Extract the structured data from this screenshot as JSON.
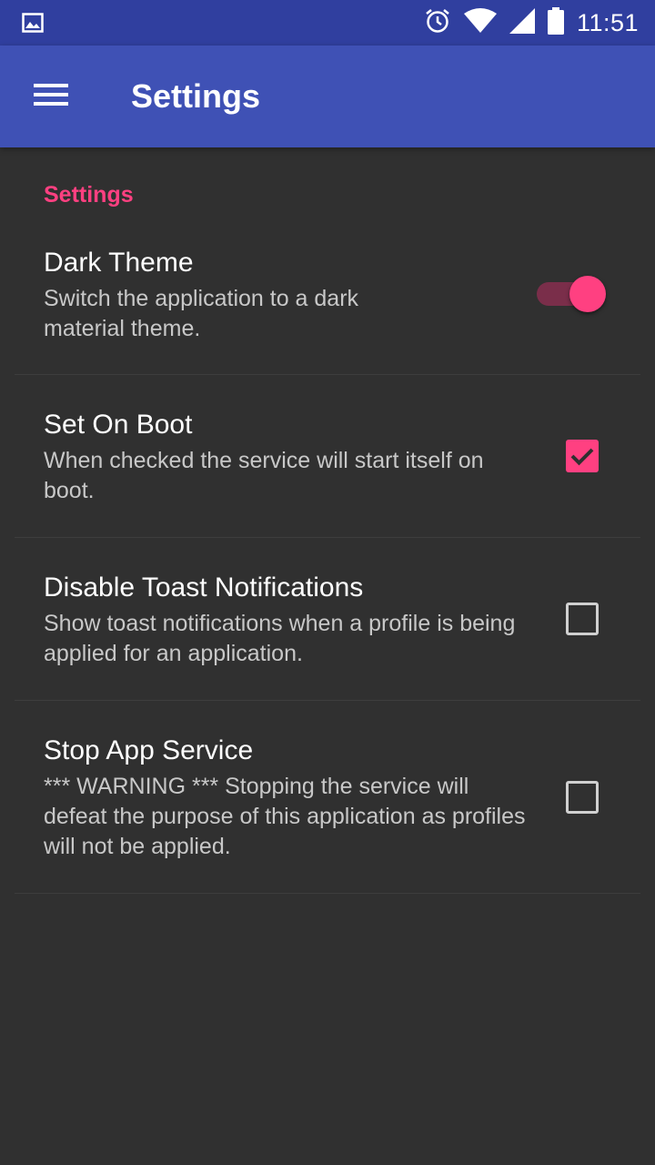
{
  "status_bar": {
    "time": "11:51",
    "icons": [
      "image-notification-icon",
      "alarm-icon",
      "wifi-icon",
      "signal-icon",
      "battery-icon"
    ]
  },
  "app_bar": {
    "title": "Settings",
    "menu_icon": "hamburger-menu-icon"
  },
  "section": {
    "header": "Settings"
  },
  "preferences": [
    {
      "title": "Dark Theme",
      "summary": "Switch the application to a dark material theme.",
      "control": "switch",
      "checked": true
    },
    {
      "title": "Set On Boot",
      "summary": "When checked the service will start itself on boot.",
      "control": "checkbox",
      "checked": true
    },
    {
      "title": "Disable Toast Notifications",
      "summary": "Show toast notifications when a profile is being applied for an application.",
      "control": "checkbox",
      "checked": false
    },
    {
      "title": "Stop App Service",
      "summary": "*** WARNING *** Stopping the service will defeat the purpose of this application as profiles will not be applied.",
      "control": "checkbox",
      "checked": false
    }
  ],
  "colors": {
    "status_bar": "#303F9F",
    "app_bar": "#3F51B5",
    "accent": "#FF4081",
    "background": "#303030"
  }
}
